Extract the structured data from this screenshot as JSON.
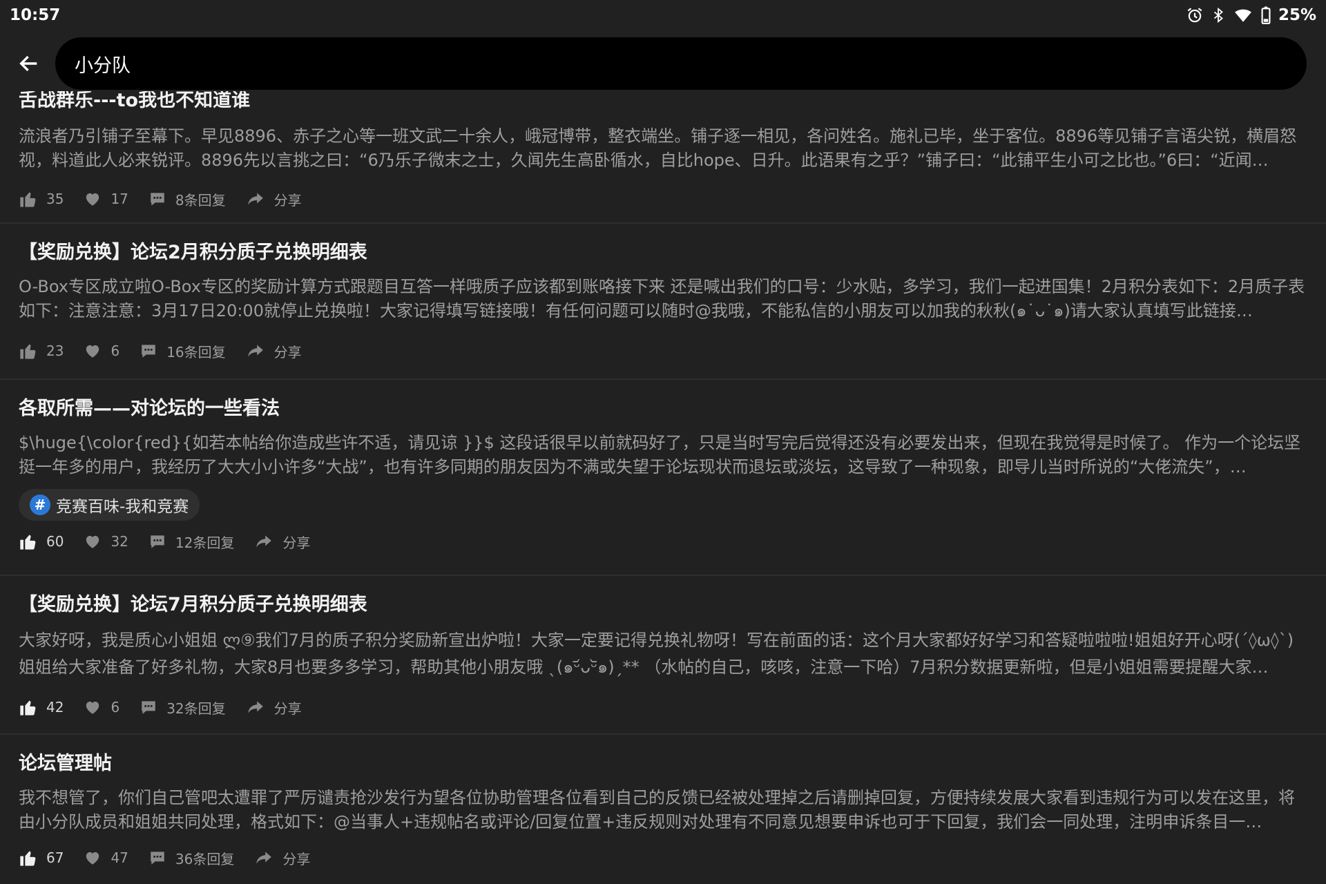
{
  "status_bar": {
    "time": "10:57",
    "battery": "25%",
    "icons": [
      "alarm-icon",
      "bluetooth-icon",
      "wifi-icon",
      "battery-icon"
    ]
  },
  "search": {
    "query": "小分队"
  },
  "posts": [
    {
      "title": "舌战群乐---to我也不知道谁",
      "body": "流浪者乃引铺子至幕下。早见8896、赤子之心等一班文武二十余人，峨冠博带，整衣端坐。铺子逐一相见，各问姓名。施礼已毕，坐于客位。8896等见铺子言语尖锐，横眉怒视，料道此人必来锐评。8896先以言挑之曰：“6乃乐子微末之士，久闻先生高卧循水，自比hope、日升。此语果有之乎？”铺子曰：“此铺平生小可之比也。”6曰：“近闻…",
      "tag": "",
      "likes": "35",
      "favorites": "17",
      "replies": "8条回复",
      "share": "分享"
    },
    {
      "title": "【奖励兑换】论坛2月积分质子兑换明细表",
      "body": "O-Box专区成立啦O-Box专区的奖励计算方式跟题目互答一样哦质子应该都到账咯接下来 还是喊出我们的口号：少水贴，多学习，我们一起进国集！2月积分表如下：2月质子表如下：注意注意：3月17日20:00就停止兑换啦！大家记得填写链接哦！有任何问题可以随时@我哦，不能私信的小朋友可以加我的秋秋(๑˙ᴗ˙๑)请大家认真填写此链接…",
      "tag": "",
      "likes": "23",
      "favorites": "6",
      "replies": "16条回复",
      "share": "分享"
    },
    {
      "title": "各取所需——对论坛的一些看法",
      "body": " $\\huge{\\color{red}{如若本帖给你造成些许不适，请见谅 }}$      这段话很早以前就码好了，只是当时写完后觉得还没有必要发出来，但现在我觉得是时候了。      作为一个论坛坚挺一年多的用户，我经历了大大小小许多“大战”，也有许多同期的朋友因为不满或失望于论坛现状而退坛或淡坛，这导致了一种现象，即导儿当时所说的“大佬流失”，…",
      "tag": "竞赛百味-我和竞赛",
      "likes": "60",
      "favorites": "32",
      "replies": "12条回复",
      "share": "分享"
    },
    {
      "title": "【奖励兑换】论坛7月积分质子兑换明细表",
      "body": "大家好呀，我是质心小姐姐 ლ⑨我们7月的质子积分奖励新宣出炉啦！大家一定要记得兑换礼物呀！写在前面的话：这个月大家都好好学习和答疑啦啦啦!姐姐好开心呀(´◊ω◊`)姐姐给大家准备了好多礼物，大家8月也要多多学习，帮助其他小朋友哦 ˎ(๑ᵕ᷄ᴗᵕ᷅๑)ˏ** （水帖的自己，咳咳，注意一下哈）7月积分数据更新啦，但是小姐姐需要提醒大家…",
      "tag": "",
      "likes": "42",
      "favorites": "6",
      "replies": "32条回复",
      "share": "分享"
    },
    {
      "title": "论坛管理帖",
      "body": "我不想管了，你们自己管吧太遭罪了严厉谴责抢沙发行为望各位协助管理各位看到自己的反馈已经被处理掉之后请删掉回复，方便持续发展大家看到违规行为可以发在这里，将由小分队成员和姐姐共同处理，格式如下：@当事人+违规帖名或评论/回复位置+违反规则对处理有不同意见想要申诉也可于下回复，我们会一同处理，注明申诉条目一…",
      "tag": "",
      "likes": "67",
      "favorites": "47",
      "replies": "36条回复",
      "share": "分享"
    }
  ],
  "colors": {
    "background": "#212121",
    "search_box": "#000000",
    "tag_icon": "#2a79d6",
    "muted_text": "#9e9e9e"
  }
}
